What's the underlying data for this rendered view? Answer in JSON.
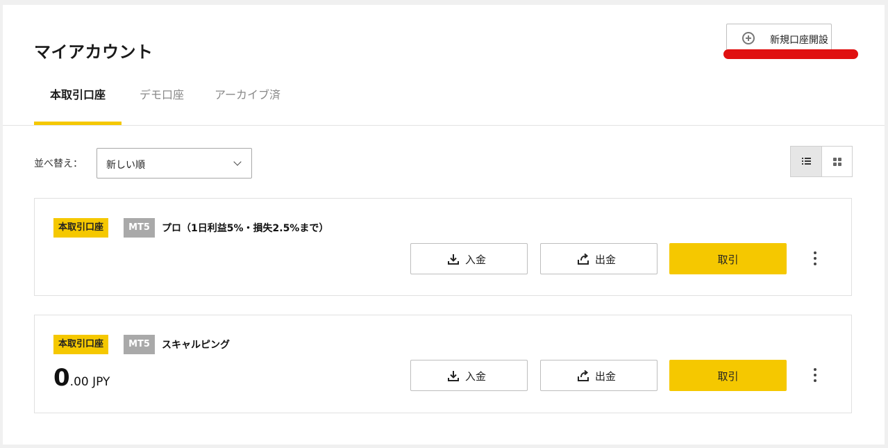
{
  "header": {
    "title": "マイアカウント",
    "new_account_label": "新規口座開設"
  },
  "tabs": [
    {
      "label": "本取引口座",
      "active": true
    },
    {
      "label": "デモ口座",
      "active": false
    },
    {
      "label": "アーカイブ済",
      "active": false
    }
  ],
  "sort": {
    "label": "並べ替え：",
    "selected": "新しい順"
  },
  "view_toggle": {
    "active": "list"
  },
  "accounts": [
    {
      "type_badge": "本取引口座",
      "platform_badge": "MT5",
      "name": "プロ（1日利益5%・損失2.5%まで）",
      "deposit_label": "入金",
      "withdraw_label": "出金",
      "trade_label": "取引"
    },
    {
      "type_badge": "本取引口座",
      "platform_badge": "MT5",
      "name": "スキャルピング",
      "balance_int": "0",
      "balance_rest": ".00 JPY",
      "deposit_label": "入金",
      "withdraw_label": "出金",
      "trade_label": "取引"
    }
  ],
  "colors": {
    "accent": "#f5c800",
    "badge_gray": "#a9a9a9",
    "annotation_red": "#e01010"
  }
}
